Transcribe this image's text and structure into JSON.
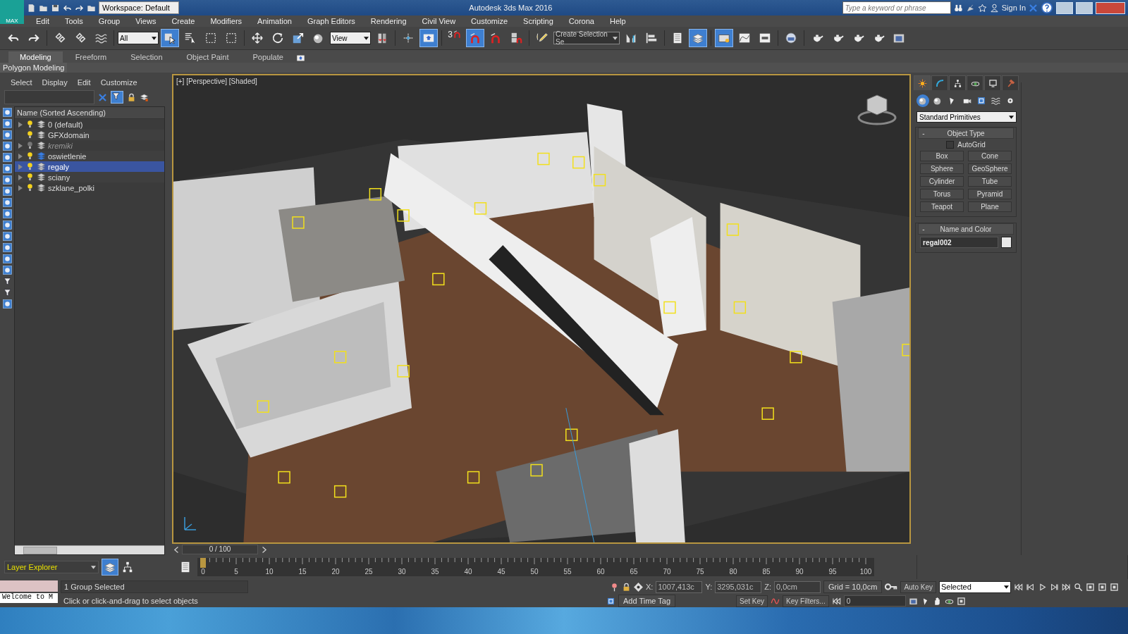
{
  "title_bar": {
    "logo": "MAX",
    "workspace": "Workspace: Default",
    "title": "Autodesk 3ds Max 2016",
    "search_placeholder": "Type a keyword or phrase",
    "sign_in": "Sign In"
  },
  "menu": [
    "Edit",
    "Tools",
    "Group",
    "Views",
    "Create",
    "Modifiers",
    "Animation",
    "Graph Editors",
    "Rendering",
    "Civil View",
    "Customize",
    "Scripting",
    "Corona",
    "Help"
  ],
  "toolbar": [
    {
      "kind": "icon",
      "active": false
    },
    {
      "kind": "icon",
      "active": false
    },
    {
      "kind": "sep"
    },
    {
      "kind": "icon",
      "active": false
    },
    {
      "kind": "icon",
      "active": false
    },
    {
      "kind": "icon",
      "active": false
    },
    {
      "kind": "sep"
    },
    {
      "kind": "dropdown",
      "value": "All",
      "wide": false
    },
    {
      "kind": "icon",
      "active": true
    },
    {
      "kind": "icon",
      "active": false
    },
    {
      "kind": "icon",
      "active": false
    },
    {
      "kind": "icon",
      "active": false
    },
    {
      "kind": "sep"
    },
    {
      "kind": "icon",
      "active": false
    },
    {
      "kind": "icon",
      "active": false
    },
    {
      "kind": "icon",
      "active": false
    },
    {
      "kind": "icon",
      "active": false
    },
    {
      "kind": "dropdown",
      "value": "View",
      "wide": false
    },
    {
      "kind": "icon",
      "active": false
    },
    {
      "kind": "sep"
    },
    {
      "kind": "icon",
      "active": false
    },
    {
      "kind": "icon",
      "active": true
    },
    {
      "kind": "sep"
    },
    {
      "kind": "snap",
      "label": "3",
      "active": false
    },
    {
      "kind": "icon",
      "active": true
    },
    {
      "kind": "icon",
      "active": false
    },
    {
      "kind": "icon",
      "active": false
    },
    {
      "kind": "sep"
    },
    {
      "kind": "icon",
      "active": false
    },
    {
      "kind": "dropdown",
      "value": "Create Selection Se",
      "wide": true
    },
    {
      "kind": "icon",
      "active": false
    },
    {
      "kind": "icon",
      "active": false
    },
    {
      "kind": "sep"
    },
    {
      "kind": "icon",
      "active": false
    },
    {
      "kind": "icon",
      "active": true
    },
    {
      "kind": "sep"
    },
    {
      "kind": "icon",
      "active": true
    },
    {
      "kind": "icon",
      "active": false
    },
    {
      "kind": "icon",
      "active": false
    },
    {
      "kind": "sep"
    },
    {
      "kind": "icon",
      "active": false
    },
    {
      "kind": "sep"
    },
    {
      "kind": "icon",
      "active": false
    },
    {
      "kind": "icon",
      "active": false
    },
    {
      "kind": "icon",
      "active": false
    },
    {
      "kind": "icon",
      "active": false
    },
    {
      "kind": "icon",
      "active": false
    }
  ],
  "ribbon": {
    "tabs": [
      {
        "label": "Modeling",
        "selected": true
      },
      {
        "label": "Freeform",
        "selected": false
      },
      {
        "label": "Selection",
        "selected": false
      },
      {
        "label": "Object Paint",
        "selected": false
      },
      {
        "label": "Populate",
        "selected": false
      }
    ],
    "panel": "Polygon Modeling"
  },
  "scene_explorer": {
    "menu": [
      "Select",
      "Display",
      "Edit",
      "Customize"
    ],
    "column": "Name (Sorted Ascending)",
    "layers": [
      {
        "name": "0 (default)",
        "expandable": true,
        "hidden": false,
        "current": false,
        "selected": false
      },
      {
        "name": "GFXdomain",
        "expandable": false,
        "hidden": false,
        "current": false,
        "selected": false
      },
      {
        "name": "kremiki",
        "expandable": true,
        "hidden": true,
        "current": false,
        "selected": false
      },
      {
        "name": "oswietlenie",
        "expandable": true,
        "hidden": false,
        "current": true,
        "selected": false
      },
      {
        "name": "regaly",
        "expandable": true,
        "hidden": false,
        "current": false,
        "selected": true
      },
      {
        "name": "sciany",
        "expandable": true,
        "hidden": false,
        "current": false,
        "selected": false
      },
      {
        "name": "szklane_polki",
        "expandable": true,
        "hidden": false,
        "current": false,
        "selected": false
      }
    ],
    "footer": "Layer Explorer"
  },
  "viewport": {
    "label": "[+] [Perspective] [Shaded]",
    "scrubber": "0 / 100"
  },
  "timeline": {
    "ticks": [
      "0",
      "5",
      "10",
      "15",
      "20",
      "25",
      "30",
      "35",
      "40",
      "45",
      "50",
      "55",
      "60",
      "65",
      "70",
      "75",
      "80",
      "85",
      "90",
      "95",
      "100"
    ]
  },
  "command_panel": {
    "tabs": [
      {
        "selected": true
      },
      {
        "selected": false
      },
      {
        "selected": false
      },
      {
        "selected": false
      },
      {
        "selected": false
      },
      {
        "selected": false
      }
    ],
    "categories": [
      {
        "selected": true
      },
      {
        "selected": false
      },
      {
        "selected": false
      },
      {
        "selected": false
      },
      {
        "selected": false
      },
      {
        "selected": false
      },
      {
        "selected": false
      }
    ],
    "dropdown": "Standard Primitives",
    "object_type": {
      "sign": "-",
      "title": "Object Type",
      "autogrid": {
        "label": "AutoGrid",
        "checked": false
      },
      "buttons": [
        "Box",
        "Cone",
        "Sphere",
        "GeoSphere",
        "Cylinder",
        "Tube",
        "Torus",
        "Pyramid",
        "Teapot",
        "Plane"
      ]
    },
    "name_and_color": {
      "sign": "-",
      "title": "Name and Color",
      "name": "regal002"
    }
  },
  "status": {
    "listener": "Welcome to M",
    "selection": "1 Group Selected",
    "prompt": "Click or click-and-drag to select objects",
    "x_label": "X:",
    "x": "1007,413c",
    "y_label": "Y:",
    "y": "3295,031c",
    "z_label": "Z:",
    "z": "0,0cm",
    "grid": "Grid = 10,0cm",
    "add_time_tag": "Add Time Tag",
    "auto_key": "Auto Key",
    "set_key": "Set Key",
    "key_mode": "Selected",
    "key_filters": "Key Filters...",
    "frame": "0"
  }
}
